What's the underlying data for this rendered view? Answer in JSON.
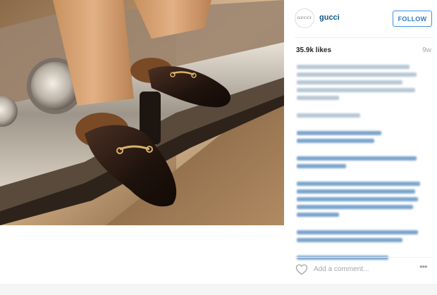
{
  "post": {
    "username": "gucci",
    "avatar_text": "GUCCI",
    "follow_label": "FOLLOW",
    "likes": "35.9k likes",
    "age": "9w",
    "comment_placeholder": "Add a comment...",
    "more_label": "•••"
  },
  "photo": {
    "subject": "fur-lined horsebit loafers on car bumper",
    "colors": {
      "sky": "#c9a27a",
      "car_chrome": "#cfc7bc",
      "pants": "#d9a47a",
      "loafer": "#2a1a12",
      "fur": "#7a4a26",
      "ground": "#6e5236"
    }
  },
  "icons": {
    "heart": "heart-icon",
    "more": "more-options-icon"
  },
  "colors": {
    "username": "#125688",
    "follow_border": "#4090db",
    "follow_text": "#2d7bc7",
    "muted": "#a5a7aa"
  }
}
